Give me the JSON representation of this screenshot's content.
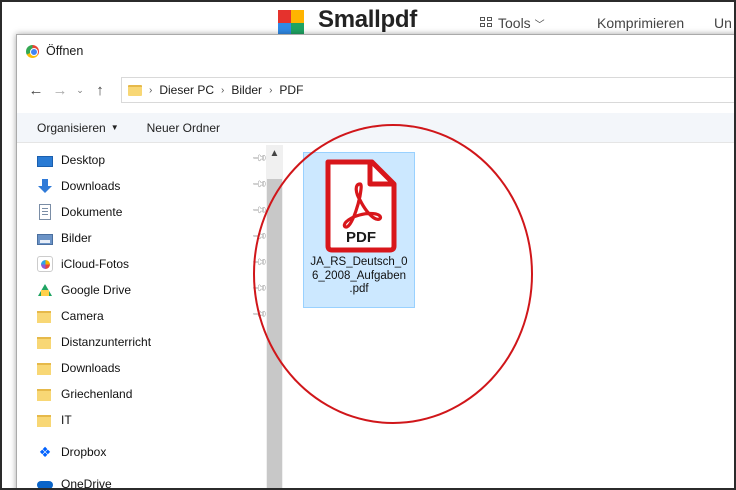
{
  "background_site": {
    "brand": "Smallpdf",
    "nav": [
      "Tools",
      "Komprimieren",
      "Un"
    ],
    "logo_colors": [
      "#e5322d",
      "#ffb400",
      "#2f8ae6",
      "#1fa463"
    ]
  },
  "dialog": {
    "title": "Öffnen",
    "title_icon": "chrome-icon",
    "breadcrumb": [
      "Dieser PC",
      "Bilder",
      "PDF"
    ],
    "toolbar": {
      "organize_label": "Organisieren",
      "new_folder_label": "Neuer Ordner"
    },
    "sidebar": {
      "items": [
        {
          "label": "Desktop",
          "icon": "desktop-icon",
          "pinned": true
        },
        {
          "label": "Downloads",
          "icon": "downloads-icon",
          "pinned": true
        },
        {
          "label": "Dokumente",
          "icon": "documents-icon",
          "pinned": true
        },
        {
          "label": "Bilder",
          "icon": "pictures-icon",
          "pinned": true
        },
        {
          "label": "iCloud-Fotos",
          "icon": "icloud-photos-icon",
          "pinned": true
        },
        {
          "label": "Google Drive",
          "icon": "google-drive-icon",
          "pinned": true
        },
        {
          "label": "Camera",
          "icon": "folder-icon",
          "pinned": true
        },
        {
          "label": "Distanzunterricht",
          "icon": "folder-icon",
          "pinned": false
        },
        {
          "label": "Downloads",
          "icon": "folder-icon",
          "pinned": false
        },
        {
          "label": "Griechenland",
          "icon": "folder-icon",
          "pinned": false
        },
        {
          "label": "IT",
          "icon": "folder-icon",
          "pinned": false
        },
        {
          "label": "Dropbox",
          "icon": "dropbox-icon",
          "pinned": false
        },
        {
          "label": "OneDrive",
          "icon": "onedrive-icon",
          "pinned": false
        }
      ]
    },
    "files": [
      {
        "name_lines": [
          "JA_RS_Deutsch_0",
          "6_2008_Aufgaben",
          ".pdf"
        ],
        "icon_label": "PDF",
        "icon": "pdf-file-icon",
        "selected": true
      }
    ]
  },
  "colors": {
    "selection_bg": "#cce8ff",
    "annotation": "#d0161a",
    "pdf_red": "#d8161b"
  }
}
